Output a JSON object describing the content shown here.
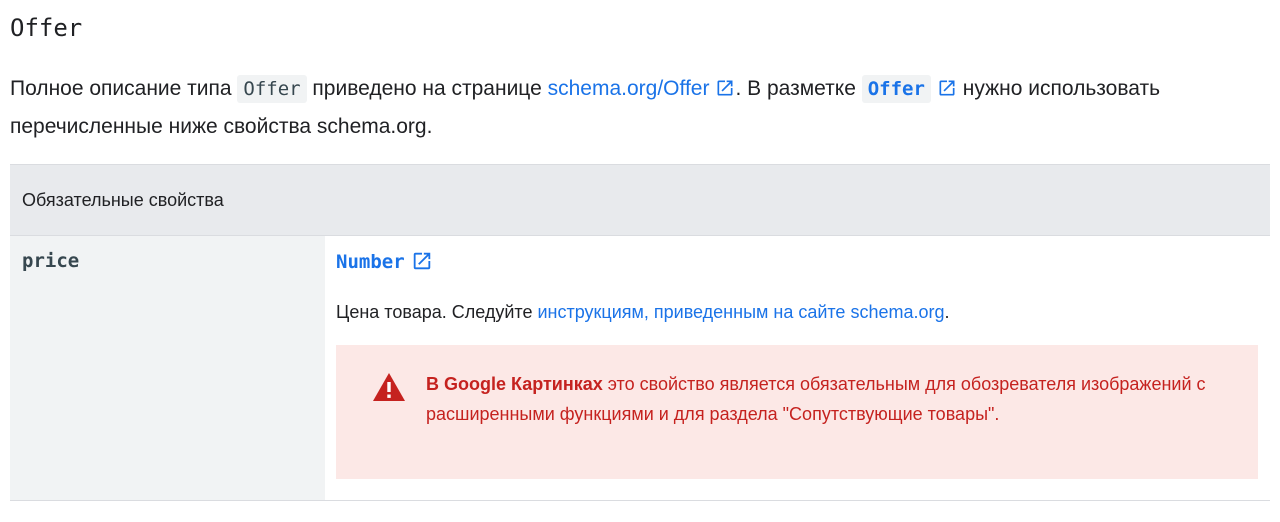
{
  "section": {
    "title": "Offer"
  },
  "intro": {
    "part1": "Полное описание типа ",
    "code_offer": "Offer",
    "part2": " приведено на странице ",
    "link_schema": "schema.org/Offer",
    "part3": ". В разметке ",
    "code_offer_link": "Offer",
    "part4": " нужно использовать перечисленные ниже свойства schema.org."
  },
  "table": {
    "header": "Обязательные свойства",
    "rows": [
      {
        "property": "price",
        "type": "Number",
        "desc_prefix": "Цена товара. Следуйте ",
        "desc_link": "инструкциям, приведенным на сайте schema.org",
        "desc_suffix": ".",
        "warning": {
          "bold": "В Google Картинках",
          "text": " это свойство является обязательным для обозревателя изображений с расширенными функциями и для раздела \"Сопутствующие товары\"."
        }
      }
    ]
  },
  "icons": {
    "external_link": "external-link-icon",
    "warning": "warning-icon"
  },
  "colors": {
    "link": "#1a73e8",
    "warning_text": "#c5221f",
    "warning_bg": "#fce8e6",
    "header_bg": "#e8eaed",
    "property_bg": "#f1f3f4"
  }
}
